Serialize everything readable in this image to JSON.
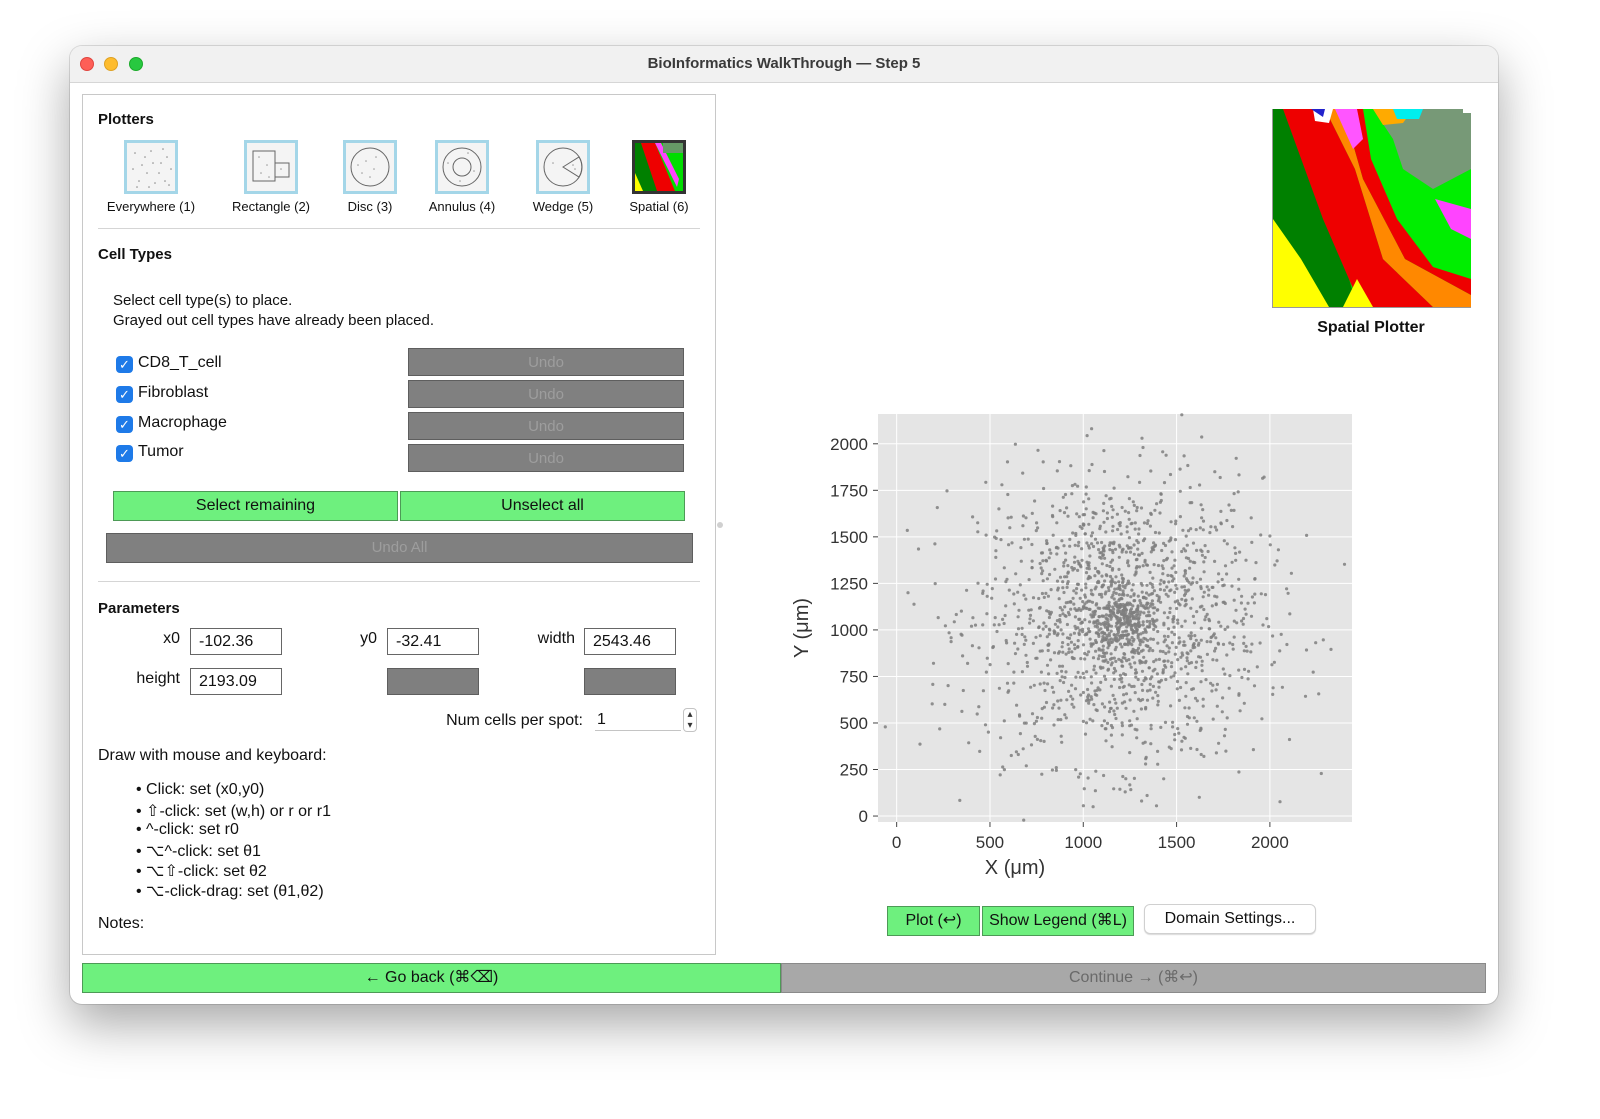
{
  "window": {
    "title": "BioInformatics WalkThrough — Step 5"
  },
  "plotters": {
    "title": "Plotters",
    "items": [
      {
        "label": "Everywhere (1)",
        "icon": "scatter-everywhere-icon"
      },
      {
        "label": "Rectangle (2)",
        "icon": "rectangle-plotter-icon"
      },
      {
        "label": "Disc (3)",
        "icon": "disc-plotter-icon"
      },
      {
        "label": "Annulus (4)",
        "icon": "annulus-plotter-icon"
      },
      {
        "label": "Wedge (5)",
        "icon": "wedge-plotter-icon"
      },
      {
        "label": "Spatial (6)",
        "icon": "spatial-plotter-icon",
        "selected": true
      }
    ]
  },
  "cell_types": {
    "title": "Cell Types",
    "instructions_line1": "Select cell type(s) to place.",
    "instructions_line2": "Grayed out cell types have already been placed.",
    "items": [
      {
        "label": "CD8_T_cell",
        "checked": true,
        "undo_label": "Undo"
      },
      {
        "label": "Fibroblast",
        "checked": true,
        "undo_label": "Undo"
      },
      {
        "label": "Macrophage",
        "checked": true,
        "undo_label": "Undo"
      },
      {
        "label": "Tumor",
        "checked": true,
        "undo_label": "Undo"
      }
    ],
    "select_remaining_label": "Select remaining",
    "unselect_all_label": "Unselect all",
    "undo_all_label": "Undo All"
  },
  "parameters": {
    "title": "Parameters",
    "x0_label": "x0",
    "x0_value": "-102.36",
    "y0_label": "y0",
    "y0_value": "-32.41",
    "width_label": "width",
    "width_value": "2543.46",
    "height_label": "height",
    "height_value": "2193.09",
    "num_cells_label": "Num cells per spot:",
    "num_cells_value": "1"
  },
  "draw_help": {
    "title": "Draw with mouse and keyboard:",
    "items": [
      "• Click: set (x0,y0)",
      "• ⇧-click: set (w,h) or r or r1",
      "• ^-click: set r0",
      "• ⌥^-click: set θ1",
      "• ⌥⇧-click: set θ2",
      "• ⌥-click-drag: set (θ1,θ2)"
    ],
    "notes_label": "Notes:"
  },
  "spatial_thumbnail": {
    "title": "Spatial Plotter"
  },
  "chart_data": {
    "type": "scatter",
    "xlabel": "X (μm)",
    "ylabel": "Y (μm)",
    "xlim": [
      -100,
      2440
    ],
    "ylim": [
      -32,
      2160
    ],
    "xticks": [
      0,
      500,
      1000,
      1500,
      2000
    ],
    "yticks": [
      0,
      250,
      500,
      750,
      1000,
      1250,
      1500,
      1750,
      2000
    ],
    "grid": true,
    "point_color": "#7f7f7f",
    "background": "#e5e5e5",
    "distribution": {
      "center": [
        1200,
        1050
      ],
      "spread": 380,
      "count": 1800
    }
  },
  "buttons": {
    "plot_label": "Plot (↩)",
    "show_legend_label": "Show Legend (⌘L)",
    "domain_settings_label": "Domain Settings...",
    "go_back_label": "← Go back (⌘⌫)",
    "continue_label": "Continue → (⌘↩)"
  },
  "colors": {
    "green_button": "#6ef07e",
    "disabled_gray": "#808080",
    "checkbox_blue": "#1e7ae8"
  }
}
